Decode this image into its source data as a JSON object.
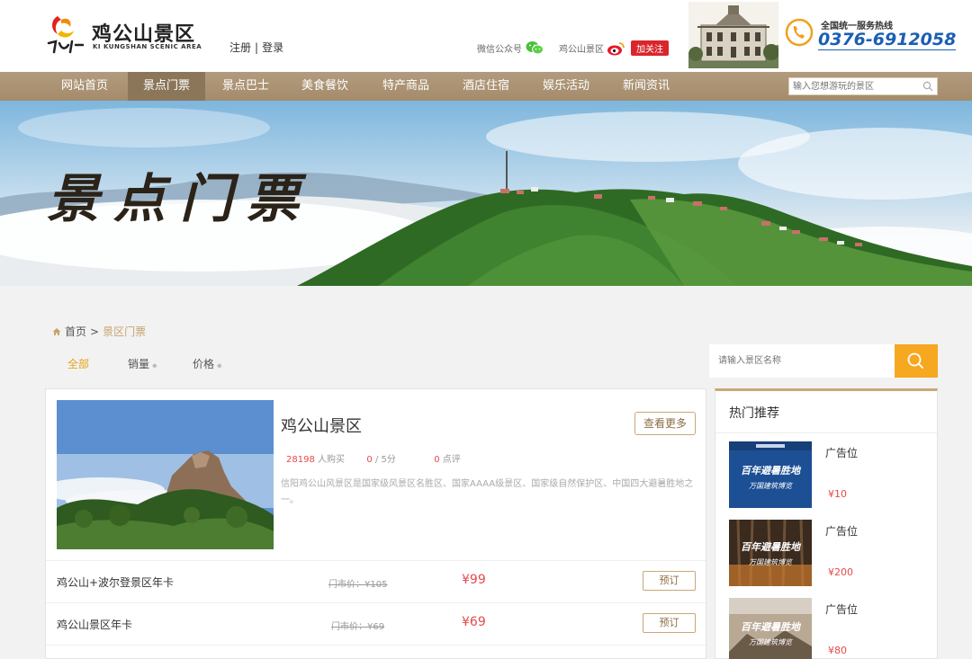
{
  "header": {
    "logo_cn": "鸡公山景区",
    "logo_en": "KI KUNGSHAN SCENIC AREA",
    "register": "注册",
    "separator": "|",
    "login": "登录",
    "wechat_label": "微信公众号",
    "weibo_label": "鸡公山景区",
    "follow": "加关注",
    "hotline_label": "全国统一服务热线",
    "hotline_number": "0376-6912058"
  },
  "nav": {
    "items": [
      "网站首页",
      "景点门票",
      "景点巴士",
      "美食餐饮",
      "特产商品",
      "酒店住宿",
      "娱乐活动",
      "新闻资讯"
    ],
    "active_index": 1,
    "search_placeholder": "输入您想游玩的景区"
  },
  "banner": {
    "title": "景点门票"
  },
  "breadcrumb": {
    "home": "首页",
    "separator": ">",
    "current": "景区门票"
  },
  "filters": {
    "all": "全部",
    "sales": "销量",
    "price": "价格"
  },
  "search": {
    "placeholder": "请输入景区名称"
  },
  "spot": {
    "title": "鸡公山景区",
    "more": "查看更多",
    "buyers": "28198",
    "buyers_suffix": "人购买",
    "score": "0",
    "score_suffix": "/ 5分",
    "reviews": "0",
    "reviews_suffix": "点评",
    "description": "信阳鸡公山风景区是国家级风景区名胜区、国家AAAA级景区、国家级自然保护区、中国四大避暑胜地之一。"
  },
  "tickets": [
    {
      "name": "鸡公山+波尔登景区年卡",
      "market": "门市价：¥105",
      "price": "¥99",
      "book": "预订"
    },
    {
      "name": "鸡公山景区年卡",
      "market": "门市价：¥69",
      "price": "¥69",
      "book": "预订"
    }
  ],
  "sidebar": {
    "title": "热门推荐",
    "ads": [
      {
        "label": "广告位",
        "price": "¥10",
        "thumb_text_1": "百年避暑胜地",
        "thumb_text_2": "万国建筑博览"
      },
      {
        "label": "广告位",
        "price": "¥200",
        "thumb_text_1": "百年避暑胜地",
        "thumb_text_2": "万国建筑博览"
      },
      {
        "label": "广告位",
        "price": "¥80",
        "thumb_text_1": "百年避暑胜地",
        "thumb_text_2": "万国建筑博览"
      }
    ]
  },
  "colors": {
    "nav_bg": "#a48b6b",
    "nav_active": "#8c765a",
    "accent_gold": "#c9a877",
    "price_red": "#e54a4a",
    "search_orange": "#f6a821",
    "hotline_blue": "#1a5fb4"
  }
}
